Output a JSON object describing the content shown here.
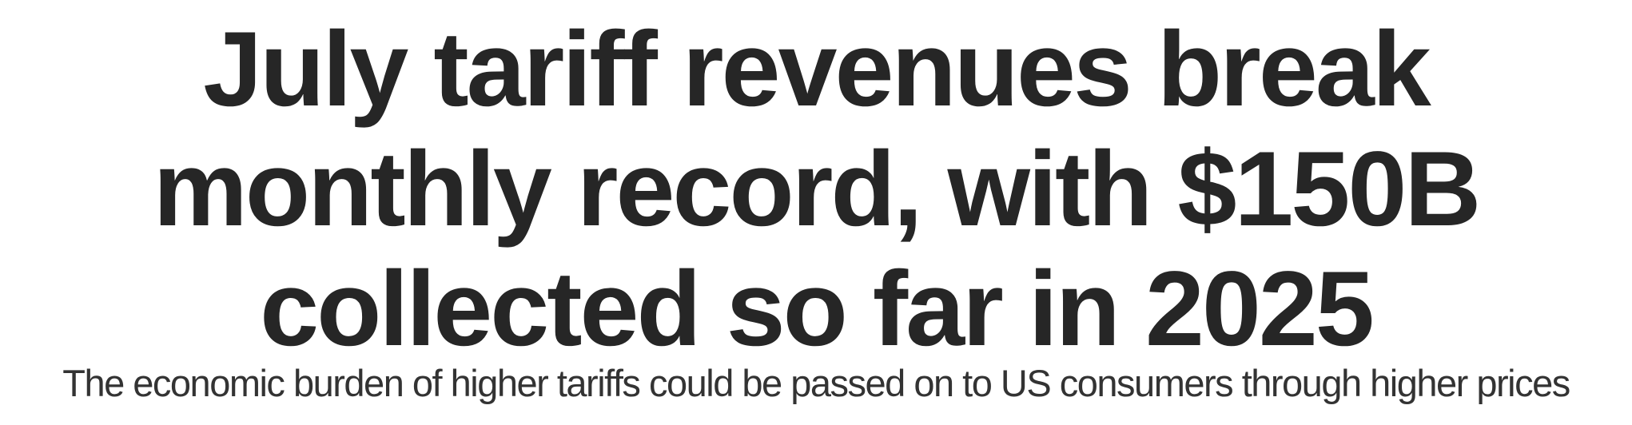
{
  "article": {
    "headline": "July tariff revenues break monthly record, with $150B collected so far in 2025",
    "subheadline": "The economic burden of higher tariffs could be passed on to US consumers through higher prices"
  }
}
